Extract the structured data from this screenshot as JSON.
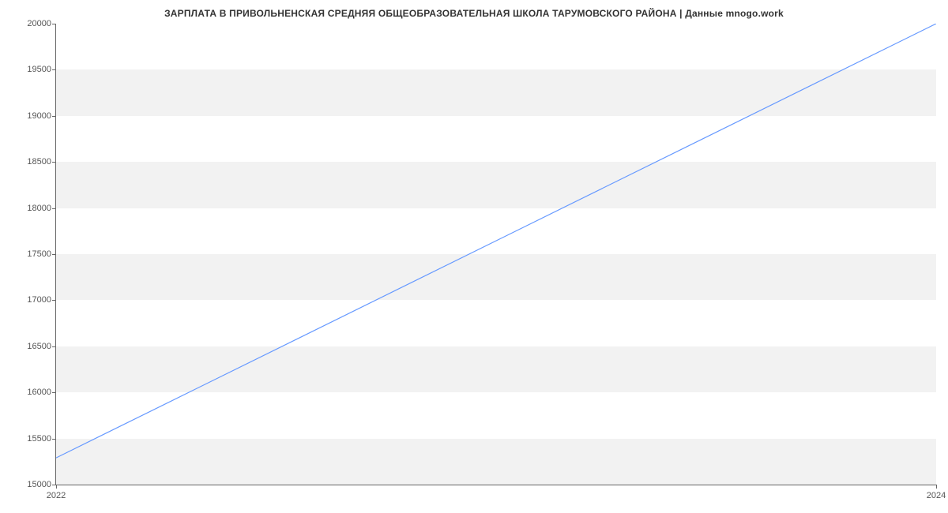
{
  "chart_data": {
    "type": "line",
    "title": "ЗАРПЛАТА В ПРИВОЛЬНЕНСКАЯ СРЕДНЯЯ ОБЩЕОБРАЗОВАТЕЛЬНАЯ ШКОЛА ТАРУМОВСКОГО РАЙОНА | Данные mnogo.work",
    "x": [
      2022,
      2024
    ],
    "values": [
      15290,
      20000
    ],
    "xlabel": "",
    "ylabel": "",
    "xlim": [
      2022,
      2024
    ],
    "ylim": [
      15000,
      20000
    ],
    "y_ticks": [
      15000,
      15500,
      16000,
      16500,
      17000,
      17500,
      18000,
      18500,
      19000,
      19500,
      20000
    ],
    "x_ticks": [
      2022,
      2024
    ],
    "line_color": "#6699ff",
    "grid": true
  }
}
